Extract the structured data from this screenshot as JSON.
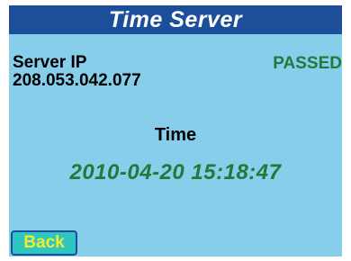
{
  "header": {
    "title": "Time Server"
  },
  "server": {
    "label": "Server IP",
    "ip": "208.053.042.077",
    "status": "PASSED"
  },
  "time": {
    "label": "Time",
    "value": "2010-04-20 15:18:47"
  },
  "buttons": {
    "back_label": "Back"
  },
  "colors": {
    "title_bar": "#1c4e99",
    "panel_background": "#87ceeb",
    "status_green": "#1f7a3c",
    "button_background": "#2fc6c2",
    "button_text": "#f2ec2b"
  }
}
